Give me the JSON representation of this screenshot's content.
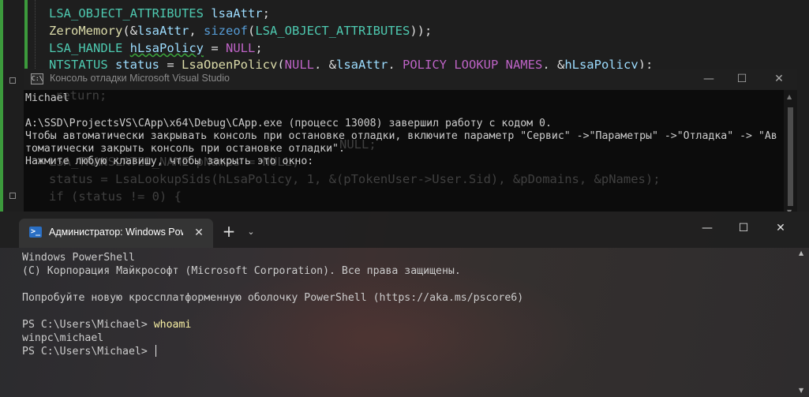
{
  "editor": {
    "lines": [
      {
        "parts": [
          [
            "LSA_OBJECT_ATTRIBUTES",
            "type"
          ],
          [
            " ",
            "punc"
          ],
          [
            "lsaAttr",
            "var"
          ],
          [
            ";",
            "punc"
          ]
        ]
      },
      {
        "parts": [
          [
            "ZeroMemory",
            "fn"
          ],
          [
            "(&",
            "punc"
          ],
          [
            "lsaAttr",
            "var"
          ],
          [
            ", ",
            "punc"
          ],
          [
            "sizeof",
            "kw"
          ],
          [
            "(",
            "punc"
          ],
          [
            "LSA_OBJECT_ATTRIBUTES",
            "type"
          ],
          [
            "));",
            "punc"
          ]
        ]
      },
      {
        "parts": [
          [
            "LSA_HANDLE",
            "type"
          ],
          [
            " ",
            "punc"
          ],
          [
            "hLsaPolicy",
            "var"
          ],
          [
            " = ",
            "punc"
          ],
          [
            "NULL",
            "mac"
          ],
          [
            ";",
            "punc"
          ]
        ]
      },
      {
        "parts": [
          [
            "NTSTATUS",
            "type"
          ],
          [
            " ",
            "punc"
          ],
          [
            "status",
            "var"
          ],
          [
            " = ",
            "punc"
          ],
          [
            "LsaOpenPolicy",
            "fn"
          ],
          [
            "(",
            "punc"
          ],
          [
            "NULL",
            "mac"
          ],
          [
            ", &",
            "punc"
          ],
          [
            "lsaAttr",
            "var"
          ],
          [
            ", ",
            "punc"
          ],
          [
            "POLICY_LOOKUP_NAMES",
            "mac"
          ],
          [
            ", &",
            "punc"
          ],
          [
            "hLsaPolicy",
            "var"
          ],
          [
            ");",
            "punc"
          ]
        ]
      }
    ],
    "ghost_lines": [
      {
        "text": "return;"
      },
      {
        "text": "NULL;"
      },
      {
        "text": "LSA_TRANSLATED_NAME pNames = NULL;"
      },
      {
        "text": "status = LsaLookupSids(hLsaPolicy, 1, &(pTokenUser->User.Sid), &pDomains, &pNames);"
      },
      {
        "text": "if (status != 0) {"
      }
    ]
  },
  "vs_console": {
    "icon_text": "C:\\",
    "title": "Консоль отладки Microsoft Visual Studio",
    "minimize": "—",
    "maximize": "☐",
    "close": "✕",
    "lines": [
      "Michael",
      "",
      "A:\\SSD\\ProjectsVS\\CApp\\x64\\Debug\\CApp.exe (процесс 13008) завершил работу с кодом 0.",
      "Чтобы автоматически закрывать консоль при остановке отладки, включите параметр \"Сервис\" ->\"Параметры\" ->\"Отладка\" -> \"Ав",
      "томатически закрыть консоль при остановке отладки\".",
      "Нажмите любую клавишу, чтобы закрыть это окно:"
    ]
  },
  "terminal": {
    "tab_icon": ">_",
    "tab_title": "Администратор: Windows PowerShell",
    "tab_close": "✕",
    "new_tab": "+",
    "dropdown": "⌄",
    "minimize": "—",
    "maximize": "☐",
    "close": "✕",
    "lines": [
      "Windows PowerShell",
      "(C) Корпорация Майкрософт (Microsoft Corporation). Все права защищены.",
      "",
      "Попробуйте новую кроссплатформенную оболочку PowerShell (https://aka.ms/pscore6)",
      ""
    ],
    "prompt1": "PS C:\\Users\\Michael> ",
    "command1": "whoami",
    "output1": "winpc\\michael",
    "prompt2": "PS C:\\Users\\Michael> "
  }
}
